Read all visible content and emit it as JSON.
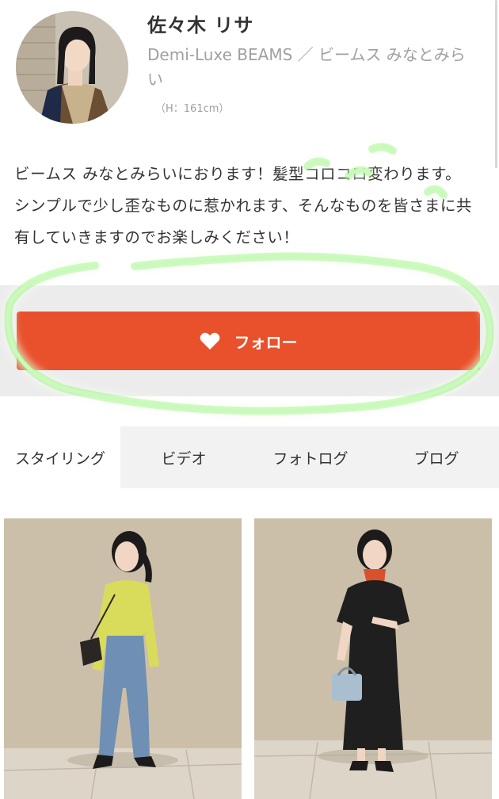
{
  "profile": {
    "name": "佐々木 リサ",
    "shop": "Demi-Luxe BEAMS ／ ビームス みなとみらい",
    "height": "（H：161cm）"
  },
  "bio": {
    "text": "ビームス みなとみらいにおります！髪型コロコロ変わります。シンプルで少し歪なものに惹かれます、そんなものを皆さまに共有していきますのでお楽しみください！"
  },
  "follow": {
    "label": "フォロー",
    "icon": "heart-icon",
    "color": "#e8512b"
  },
  "tabs": [
    {
      "label": "スタイリング",
      "active": true
    },
    {
      "label": "ビデオ",
      "active": false
    },
    {
      "label": "フォトログ",
      "active": false
    },
    {
      "label": "ブログ",
      "active": false
    }
  ],
  "photos": [
    {
      "alt": "styling-photo-yellow-cardigan-jeans"
    },
    {
      "alt": "styling-photo-black-dress-scarf"
    }
  ],
  "colors": {
    "accent": "#e8512b",
    "follow_bg": "#ececec",
    "tab_bg": "#f2f2f2",
    "highlight": "#7cf05a"
  }
}
